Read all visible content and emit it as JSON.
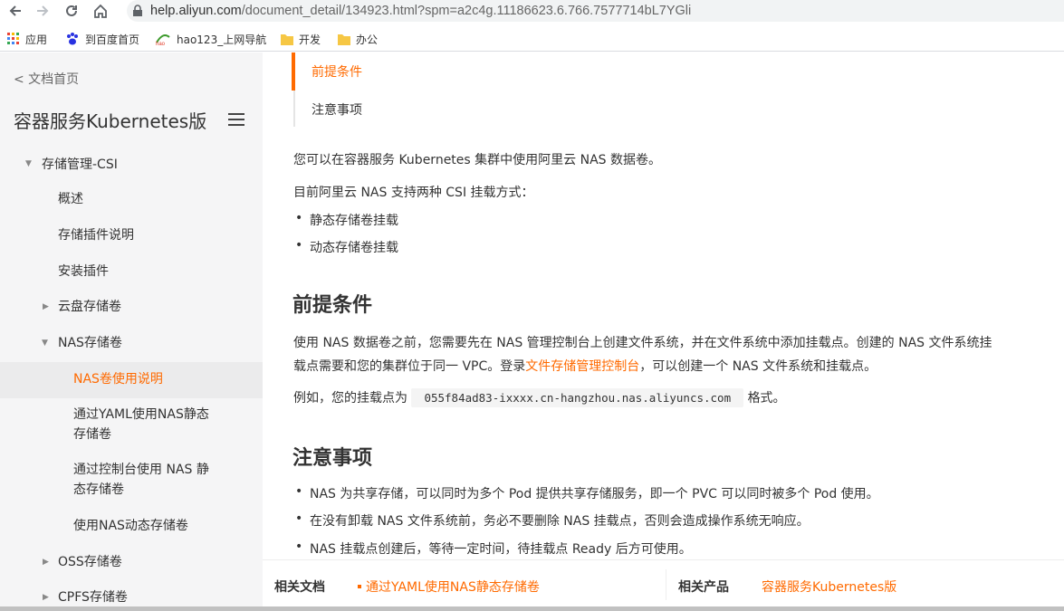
{
  "browser": {
    "url_host": "help.aliyun.com",
    "url_path": "/document_detail/134923.html?spm=a2c4g.11186623.6.766.7577714bL7YGli",
    "bookmarks": [
      {
        "label": "应用",
        "icon": "apps-grid-icon"
      },
      {
        "label": "到百度首页",
        "icon": "baidu-paw-icon"
      },
      {
        "label": "hao123_上网导航",
        "icon": "hao123-icon"
      },
      {
        "label": "开发",
        "icon": "folder-icon"
      },
      {
        "label": "办公",
        "icon": "folder-icon"
      }
    ]
  },
  "sidebar": {
    "back_label": "< 文档首页",
    "title": "容器服务Kubernetes版",
    "items": [
      {
        "label": "存储管理-CSI"
      },
      {
        "label": "概述"
      },
      {
        "label": "存储插件说明"
      },
      {
        "label": "安装插件"
      },
      {
        "label": "云盘存储卷"
      },
      {
        "label": "NAS存储卷"
      },
      {
        "label": "NAS卷使用说明"
      },
      {
        "label": "通过YAML使用NAS静态",
        "label2": "存储卷"
      },
      {
        "label": "通过控制台使用 NAS 静",
        "label2": "态存储卷"
      },
      {
        "label": "使用NAS动态存储卷"
      },
      {
        "label": "OSS存储卷"
      },
      {
        "label": "CPFS存储卷"
      }
    ]
  },
  "toc": [
    "前提条件",
    "注意事项"
  ],
  "content": {
    "intro": "您可以在容器服务 Kubernetes 集群中使用阿里云 NAS 数据卷。",
    "modes_intro": "目前阿里云 NAS 支持两种 CSI 挂载方式：",
    "modes": [
      "静态存储卷挂载",
      "动态存储卷挂载"
    ],
    "prereq_heading": "前提条件",
    "prereq_line1": "使用 NAS 数据卷之前，您需要先在 NAS 管理控制台上创建文件系统，并在文件系统中添加挂载点。创建的 NAS 文件系统挂",
    "prereq_line2_pre": "载点需要和您的集群位于同一 VPC。登录",
    "prereq_link": "文件存储管理控制台",
    "prereq_line2_post": "，可以创建一个 NAS 文件系统和挂载点。",
    "example_pre": "例如，您的挂载点为",
    "example_code": "055f84ad83-ixxxx.cn-hangzhou.nas.aliyuncs.com",
    "example_post": "格式。",
    "notes_heading": "注意事项",
    "notes": [
      "NAS 为共享存储，可以同时为多个 Pod 提供共享存储服务，即一个 PVC 可以同时被多个 Pod 使用。",
      "在没有卸载 NAS 文件系统前，务必不要删除 NAS 挂载点，否则会造成操作系统无响应。",
      "NAS 挂载点创建后，等待一定时间，待挂载点 Ready 后方可使用。"
    ]
  },
  "footer": {
    "related_docs_label": "相关文档",
    "related_docs_link": "通过YAML使用NAS静态存储卷",
    "related_products_label": "相关产品",
    "related_products_link": "容器服务Kubernetes版"
  },
  "colors": {
    "accent": "#ff6a00",
    "sidebar_bg": "#f5f5f6",
    "active_bg": "#ebebec"
  }
}
